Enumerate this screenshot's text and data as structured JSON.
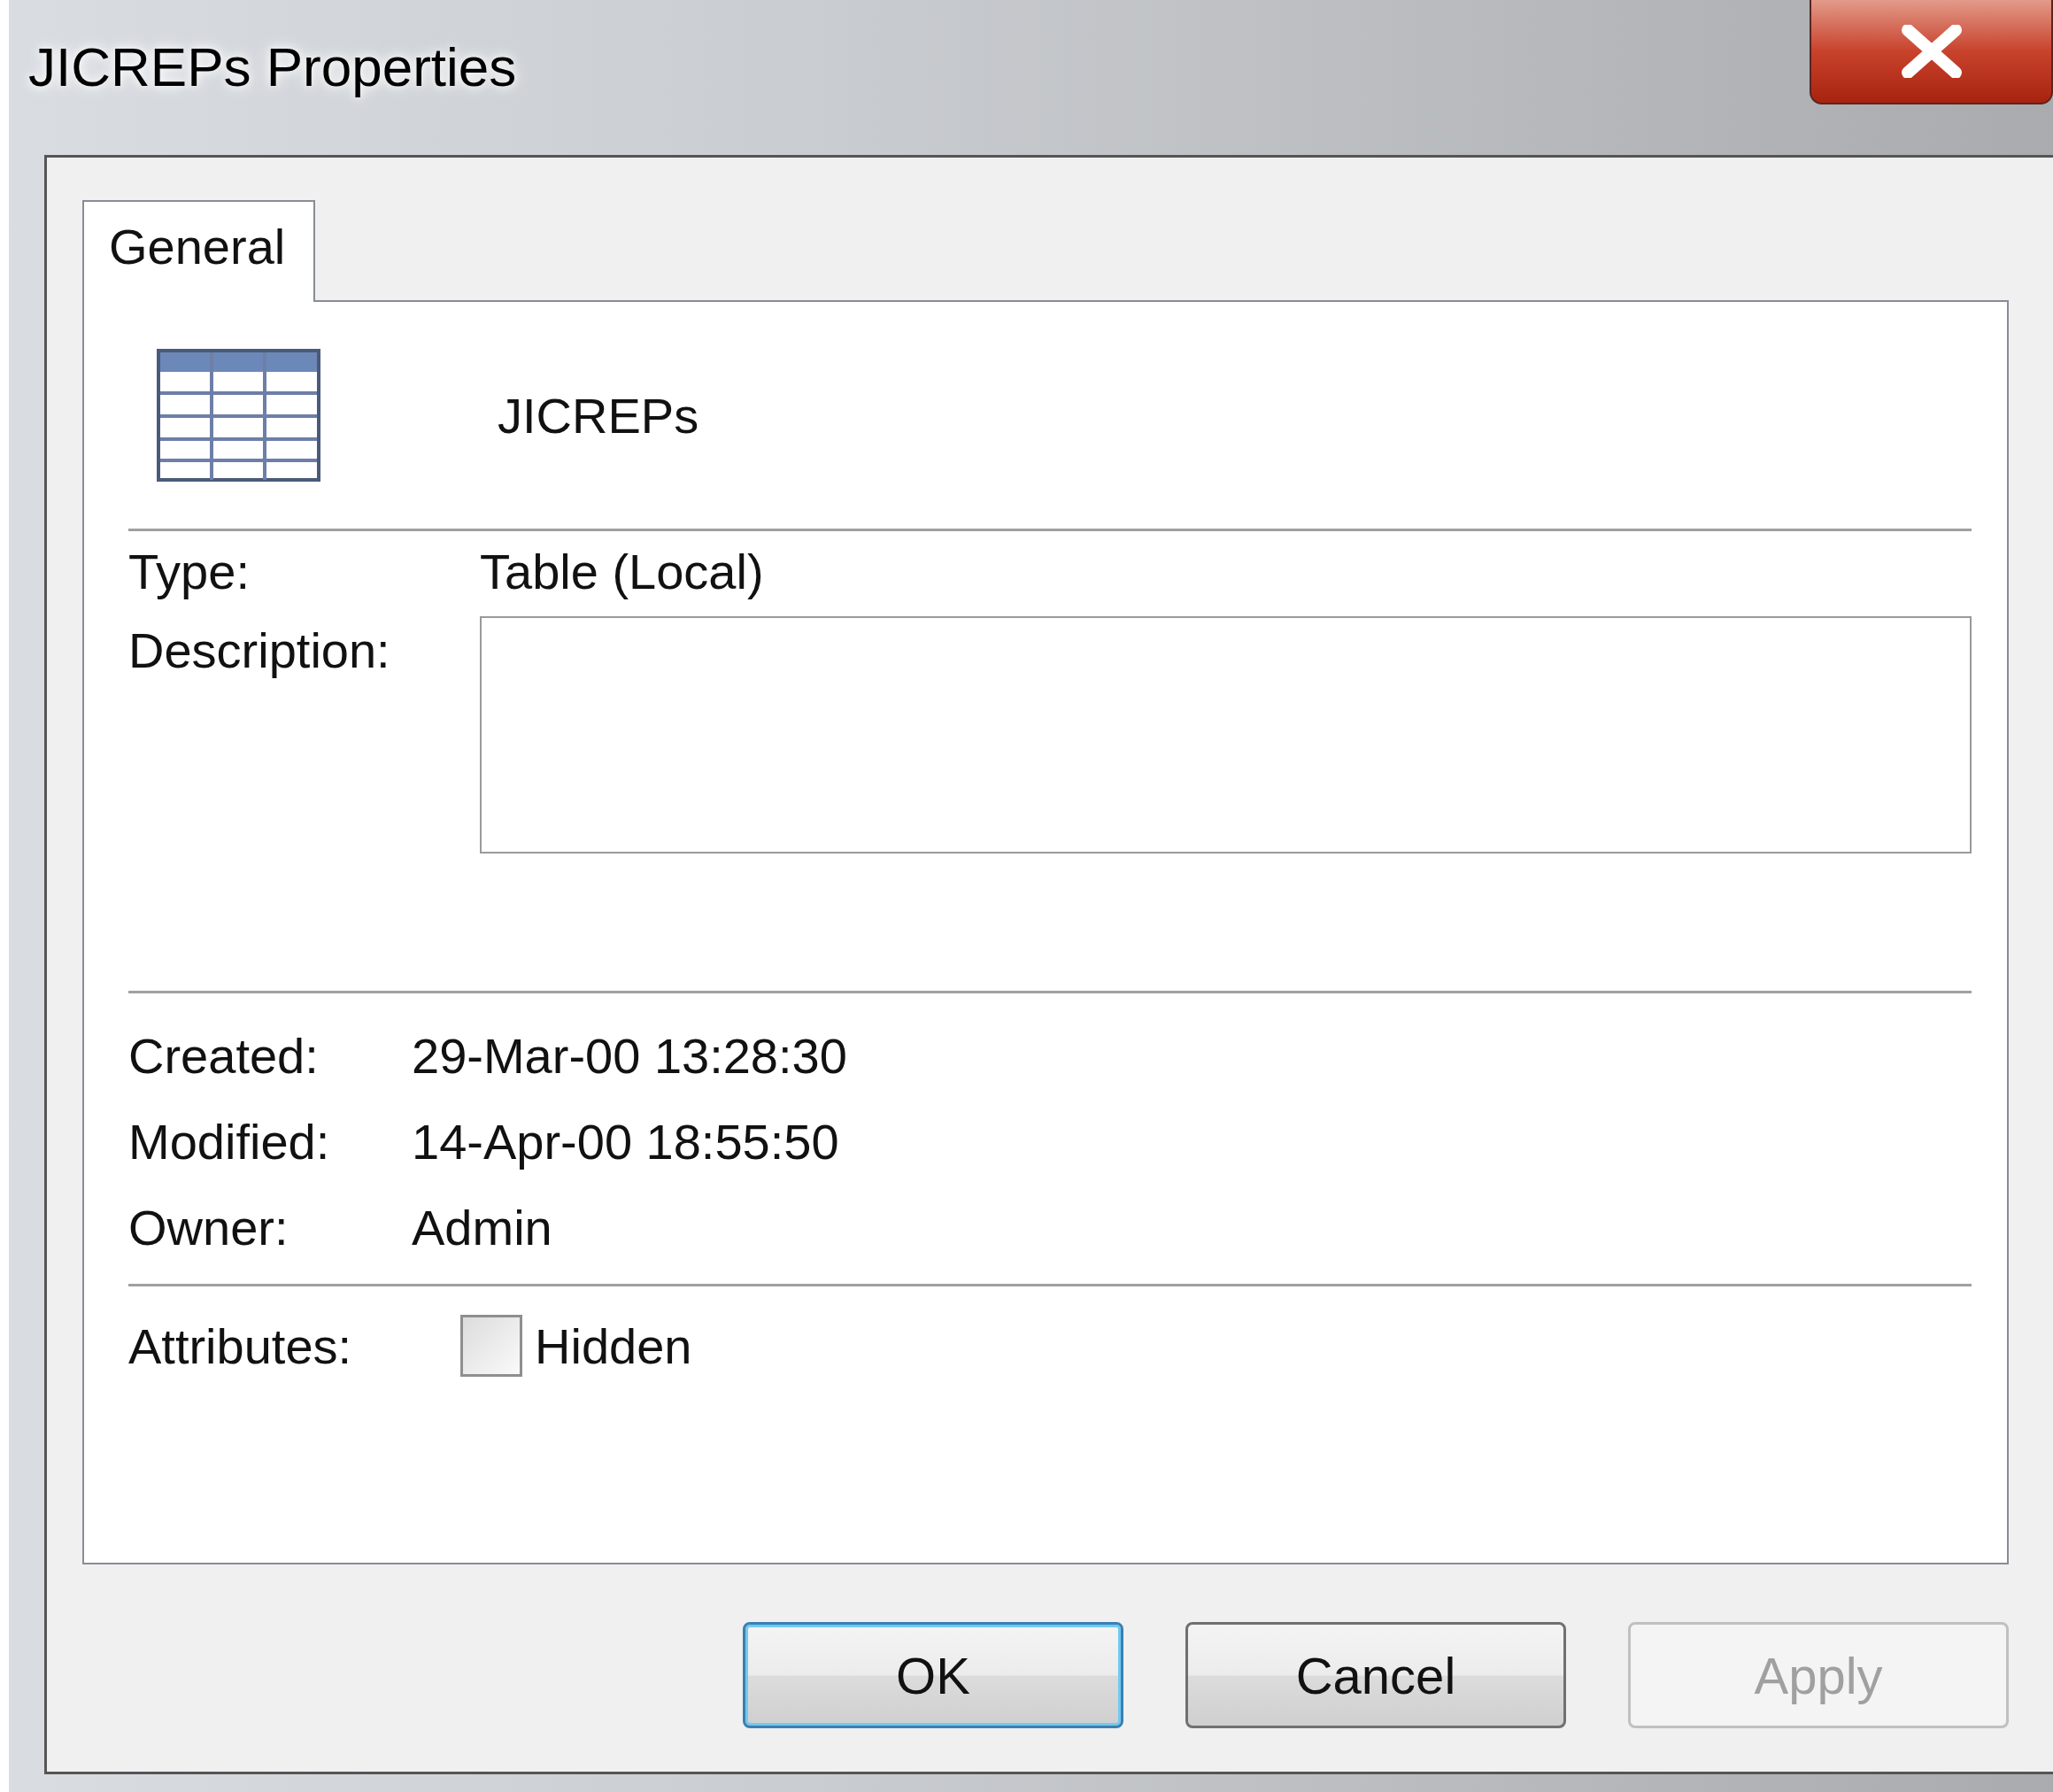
{
  "window": {
    "title": "JICREPs Properties"
  },
  "tabs": [
    {
      "label": "General",
      "selected": true
    }
  ],
  "header": {
    "name": "JICREPs"
  },
  "type": {
    "label": "Type:",
    "value": "Table (Local)"
  },
  "description": {
    "label": "Description:"
  },
  "dates": [
    {
      "label": "Created:",
      "value": "29-Mar-00 13:28:30"
    },
    {
      "label": "Modified:",
      "value": "14-Apr-00 18:55:50"
    },
    {
      "label": "Owner:",
      "value": "Admin"
    }
  ],
  "attributes": {
    "label": "Attributes:",
    "options": [
      {
        "label": "Hidden",
        "checked": false
      }
    ]
  },
  "buttons": [
    {
      "label": "OK",
      "default": true,
      "disabled": false
    },
    {
      "label": "Cancel",
      "default": false,
      "disabled": false
    },
    {
      "label": "Apply",
      "default": false,
      "disabled": true
    }
  ]
}
